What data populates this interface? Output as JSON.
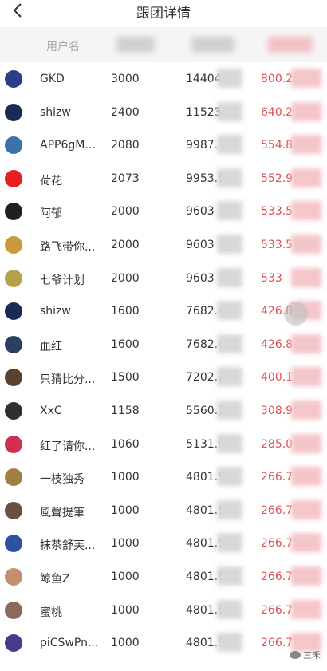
{
  "nav": {
    "title": "跟团详情"
  },
  "table": {
    "header_user": "用户名",
    "rows": [
      {
        "name": "GKD",
        "amount": "3000",
        "val1": "14404.5",
        "val2": "800.25",
        "avatar_color": "#2a3f88"
      },
      {
        "name": "shizw",
        "amount": "2400",
        "val1": "11523.6",
        "val2": "640.2",
        "avatar_color": "#1a2a55"
      },
      {
        "name": "APP6gM...",
        "amount": "2080",
        "val1": "9987.12",
        "val2": "554.84",
        "avatar_color": "#3d6fa8"
      },
      {
        "name": "荷花",
        "amount": "2073",
        "val1": "9953.51",
        "val2": "552.97",
        "avatar_color": "#e61e1e"
      },
      {
        "name": "阿郁",
        "amount": "2000",
        "val1": "9603",
        "val2": "533.5",
        "avatar_color": "#202020"
      },
      {
        "name": "路飞带你...",
        "amount": "2000",
        "val1": "9603",
        "val2": "533.5",
        "avatar_color": "#c89a3a"
      },
      {
        "name": "七爷计划",
        "amount": "2000",
        "val1": "9603",
        "val2": "533",
        "avatar_color": "#b8a04a"
      },
      {
        "name": "shizw",
        "amount": "1600",
        "val1": "7682.4",
        "val2": "426.8",
        "avatar_color": "#1a2a55"
      },
      {
        "name": "血红",
        "amount": "1600",
        "val1": "7682.4",
        "val2": "426.8",
        "avatar_color": "#2a4060"
      },
      {
        "name": "只猜比分...",
        "amount": "1500",
        "val1": "7202.25",
        "val2": "400.13",
        "avatar_color": "#5a4030"
      },
      {
        "name": "XxC",
        "amount": "1158",
        "val1": "5560.1",
        "val2": "308.9",
        "avatar_color": "#303030"
      },
      {
        "name": "红了请你...",
        "amount": "1060",
        "val1": "5131.5",
        "val2": "285.09",
        "avatar_color": "#d03050"
      },
      {
        "name": "一枝独秀",
        "amount": "1000",
        "val1": "4801.5",
        "val2": "266.75",
        "avatar_color": "#a08040"
      },
      {
        "name": "風聲提筆",
        "amount": "1000",
        "val1": "4801.5",
        "val2": "266.75",
        "avatar_color": "#6a5040"
      },
      {
        "name": "抹茶舒芙...",
        "amount": "1000",
        "val1": "4801.5",
        "val2": "266.75",
        "avatar_color": "#3050a0"
      },
      {
        "name": "鲸鱼Z",
        "amount": "1000",
        "val1": "4801.5",
        "val2": "266.75",
        "avatar_color": "#c09070"
      },
      {
        "name": "蜜桃",
        "amount": "1000",
        "val1": "4801.5",
        "val2": "266.75",
        "avatar_color": "#8a6a5a"
      },
      {
        "name": "piCSwPn...",
        "amount": "1000",
        "val1": "4801.5",
        "val2": "266.75",
        "avatar_color": "#4a3a8a"
      }
    ]
  },
  "watermark": {
    "text": "三禾"
  },
  "colors": {
    "accent_red": "#e05050",
    "header_bg": "#f5f5f5"
  }
}
